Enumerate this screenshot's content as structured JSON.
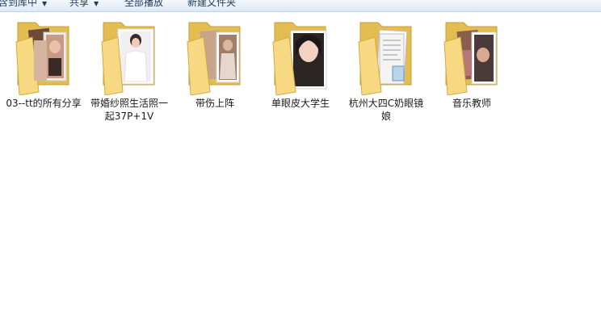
{
  "toolbar": {
    "buttons": [
      {
        "label": "包含到库中",
        "dropdown": true
      },
      {
        "label": "共享",
        "dropdown": true
      },
      {
        "label": "全部播放",
        "dropdown": false
      },
      {
        "label": "新建文件夹",
        "dropdown": false
      }
    ]
  },
  "colors": {
    "folder_back": "#e6c25a",
    "folder_front": "#f8dc8a",
    "toolbar_bg": "#dde8f5"
  },
  "files": [
    {
      "name": "03--tt的所有分享",
      "icon": "photo-folder-icon"
    },
    {
      "name": "带婚纱照生活照一起37P+1V",
      "icon": "photo-folder-icon"
    },
    {
      "name": "带伤上阵",
      "icon": "photo-folder-icon"
    },
    {
      "name": "单眼皮大学生",
      "icon": "photo-folder-icon"
    },
    {
      "name": "杭州大四C奶眼镜娘",
      "icon": "document-folder-icon"
    },
    {
      "name": "音乐教师",
      "icon": "photo-folder-icon"
    }
  ]
}
